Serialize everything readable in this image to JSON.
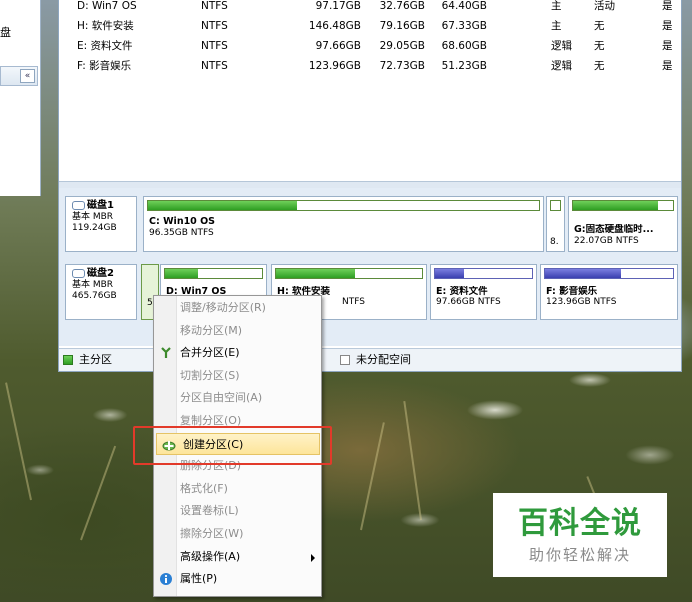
{
  "left_panel": {
    "text": "盘"
  },
  "volumes": [
    {
      "name": "D: Win7 OS",
      "fs": "NTFS",
      "capacity": "97.17GB",
      "used": "32.76GB",
      "free": "64.40GB",
      "type": "主",
      "status": "活动",
      "hidden": "是"
    },
    {
      "name": "H: 软件安装",
      "fs": "NTFS",
      "capacity": "146.48GB",
      "used": "79.16GB",
      "free": "67.33GB",
      "type": "主",
      "status": "无",
      "hidden": "是"
    },
    {
      "name": "E: 资料文件",
      "fs": "NTFS",
      "capacity": "97.66GB",
      "used": "29.05GB",
      "free": "68.60GB",
      "type": "逻辑",
      "status": "无",
      "hidden": "是"
    },
    {
      "name": "F: 影音娱乐",
      "fs": "NTFS",
      "capacity": "123.96GB",
      "used": "72.73GB",
      "free": "51.23GB",
      "type": "逻辑",
      "status": "无",
      "hidden": "是"
    }
  ],
  "disk1": {
    "title": "磁盘1",
    "type": "基本 MBR",
    "size": "119.24GB",
    "partitions": [
      {
        "name": "C: Win10 OS",
        "info": "96.35GB NTFS",
        "fill_pct": 38
      },
      {
        "name": "",
        "info": "8.",
        "fill_pct": 0
      },
      {
        "name": "G:固态硬盘临时...",
        "info": "22.07GB NTFS",
        "fill_pct": 85
      }
    ]
  },
  "disk2": {
    "title": "磁盘2",
    "type": "基本 MBR",
    "size": "465.76GB",
    "small_info": "5",
    "partitions": [
      {
        "name": "D: Win7 OS",
        "info": "",
        "fill_pct": 34
      },
      {
        "name": "H: 软件安装",
        "info": "NTFS",
        "fill_pct": 54
      },
      {
        "name": "E: 资料文件",
        "info": "97.66GB NTFS",
        "fill_pct": 30
      },
      {
        "name": "F: 影音娱乐",
        "info": "123.96GB NTFS",
        "fill_pct": 59
      }
    ]
  },
  "legend": {
    "primary": "主分区",
    "unallocated": "未分配空间"
  },
  "context_menu": {
    "items": [
      {
        "label": "调整/移动分区(R)",
        "icon": "",
        "disabled": true
      },
      {
        "label": "移动分区(M)",
        "icon": "",
        "disabled": true
      },
      {
        "label": "合并分区(E)",
        "icon": "merge-icon",
        "disabled": false
      },
      {
        "label": "切割分区(S)",
        "icon": "",
        "disabled": true
      },
      {
        "label": "分区自由空间(A)",
        "icon": "",
        "disabled": true
      },
      {
        "label": "复制分区(O)",
        "icon": "",
        "disabled": true
      },
      {
        "label": "创建分区(C)",
        "icon": "create-partition-icon",
        "disabled": false
      },
      {
        "label": "删除分区(D)",
        "icon": "",
        "disabled": true
      },
      {
        "label": "格式化(F)",
        "icon": "",
        "disabled": true
      },
      {
        "label": "设置卷标(L)",
        "icon": "",
        "disabled": true
      },
      {
        "label": "擦除分区(W)",
        "icon": "",
        "disabled": true
      },
      {
        "label": "高级操作(A)",
        "icon": "",
        "disabled": false,
        "submenu": true
      },
      {
        "label": "属性(P)",
        "icon": "info-icon",
        "disabled": false
      }
    ],
    "selected_index": 6,
    "colors": {
      "highlight_border": "#e23a2a"
    }
  },
  "brand": {
    "title": "百科全说",
    "subtitle": "助你轻松解决",
    "color": "#2f9a3c"
  }
}
